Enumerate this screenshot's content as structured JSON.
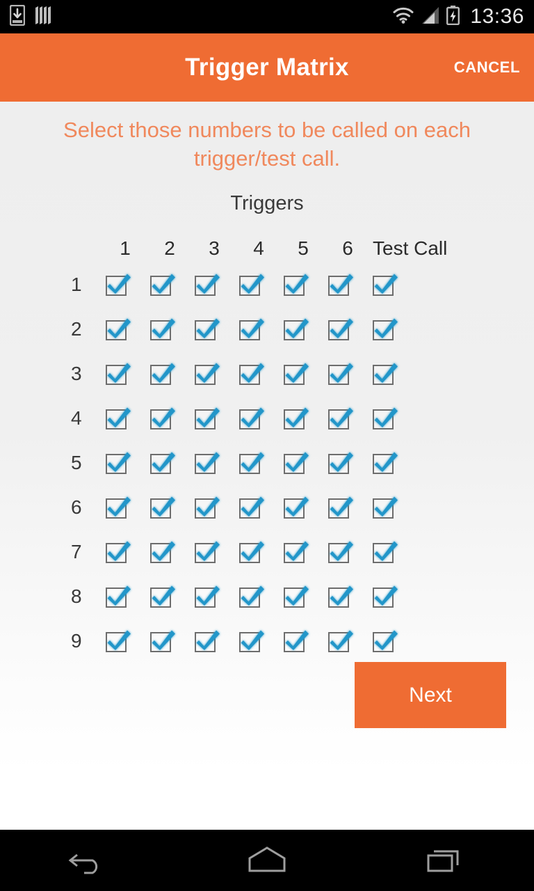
{
  "status_bar": {
    "icons_left": [
      "download-icon",
      "sim-bars-icon"
    ],
    "icons_right": [
      "wifi-icon",
      "cellular-signal-icon",
      "battery-charging-icon"
    ],
    "time": "13:36"
  },
  "action_bar": {
    "title": "Trigger Matrix",
    "cancel_label": "CANCEL",
    "background_color": "#ef6c33",
    "title_color": "#ffffff"
  },
  "content": {
    "instruction": "Select those numbers to be called on each trigger/test call.",
    "instruction_color": "#f0885c",
    "section_label": "Triggers"
  },
  "matrix": {
    "column_headers": [
      "1",
      "2",
      "3",
      "4",
      "5",
      "6",
      "Test Call"
    ],
    "row_labels": [
      "1",
      "2",
      "3",
      "4",
      "5",
      "6",
      "7",
      "8",
      "9"
    ],
    "checkbox_color": "#2196c9",
    "checkbox_border_color": "#6d6d6d",
    "checked": [
      [
        true,
        true,
        true,
        true,
        true,
        true,
        true
      ],
      [
        true,
        true,
        true,
        true,
        true,
        true,
        true
      ],
      [
        true,
        true,
        true,
        true,
        true,
        true,
        true
      ],
      [
        true,
        true,
        true,
        true,
        true,
        true,
        true
      ],
      [
        true,
        true,
        true,
        true,
        true,
        true,
        true
      ],
      [
        true,
        true,
        true,
        true,
        true,
        true,
        true
      ],
      [
        true,
        true,
        true,
        true,
        true,
        true,
        true
      ],
      [
        true,
        true,
        true,
        true,
        true,
        true,
        true
      ],
      [
        true,
        true,
        true,
        true,
        true,
        true,
        true
      ]
    ]
  },
  "next_button": {
    "label": "Next",
    "background_color": "#ef6c33",
    "text_color": "#ffffff"
  },
  "nav_bar": {
    "buttons": [
      "back-icon",
      "home-icon",
      "recents-icon"
    ]
  }
}
